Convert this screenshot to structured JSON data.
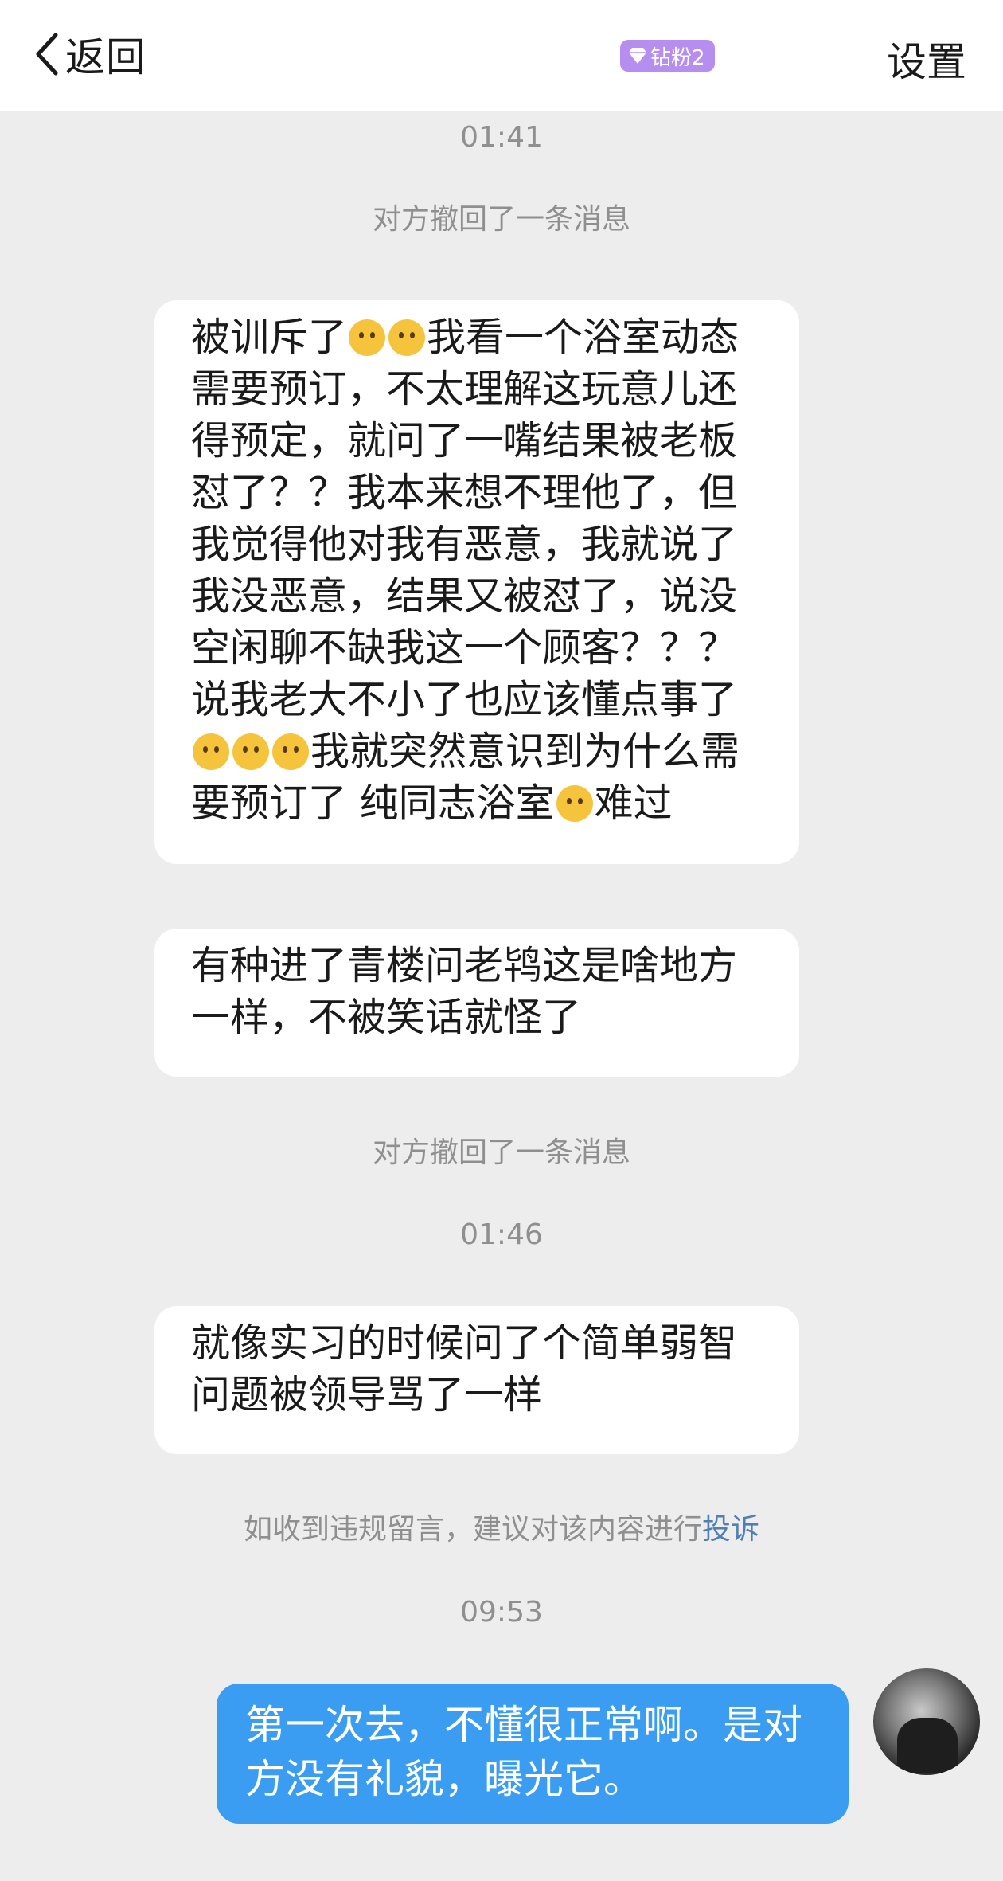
{
  "header": {
    "back_label": "返回",
    "badge_label": "钻粉2",
    "settings_label": "设置"
  },
  "messages": {
    "time1": "01:41",
    "recall1": "对方撤回了一条消息",
    "b1_l1_a": "被训斥了",
    "b1_l1_b": "我看一个浴室动态",
    "b1_l2": "需要预订，不太理解这玩意儿还",
    "b1_l3": "得预定，就问了一嘴结果被老板",
    "b1_l4": "怼了？？我本来想不理他了，但",
    "b1_l5": "我觉得他对我有恶意，我就说了",
    "b1_l6": "我没恶意，结果又被怼了，说没",
    "b1_l7": "空闲聊不缺我这一个顾客？？？",
    "b1_l8": "说我老大不小了也应该懂点事了",
    "b1_l9": "我就突然意识到为什么需",
    "b1_l10_a": "要预订了 纯同志浴室",
    "b1_l10_b": "难过",
    "b2_l1": "有种进了青楼问老鸨这是啥地方",
    "b2_l2": "一样，不被笑话就怪了",
    "recall2": "对方撤回了一条消息",
    "time2": "01:46",
    "b3_l1": "就像实习的时候问了个简单弱智",
    "b3_l2": "问题被领导骂了一样",
    "notice_text": "如收到违规留言，建议对该内容进行",
    "notice_link": "投诉",
    "time3": "09:53",
    "mine_l1": "第一次去，不懂很正常啊。是对",
    "mine_l2": "方没有礼貌，曝光它。"
  },
  "emoji": [
    "pleading-face",
    "slightly-smiling-face",
    "dizzy-face"
  ],
  "colors": {
    "background": "#ededed",
    "my_bubble": "#3a9df2",
    "badge": "#b58ef0",
    "link": "#4f7fb3"
  }
}
